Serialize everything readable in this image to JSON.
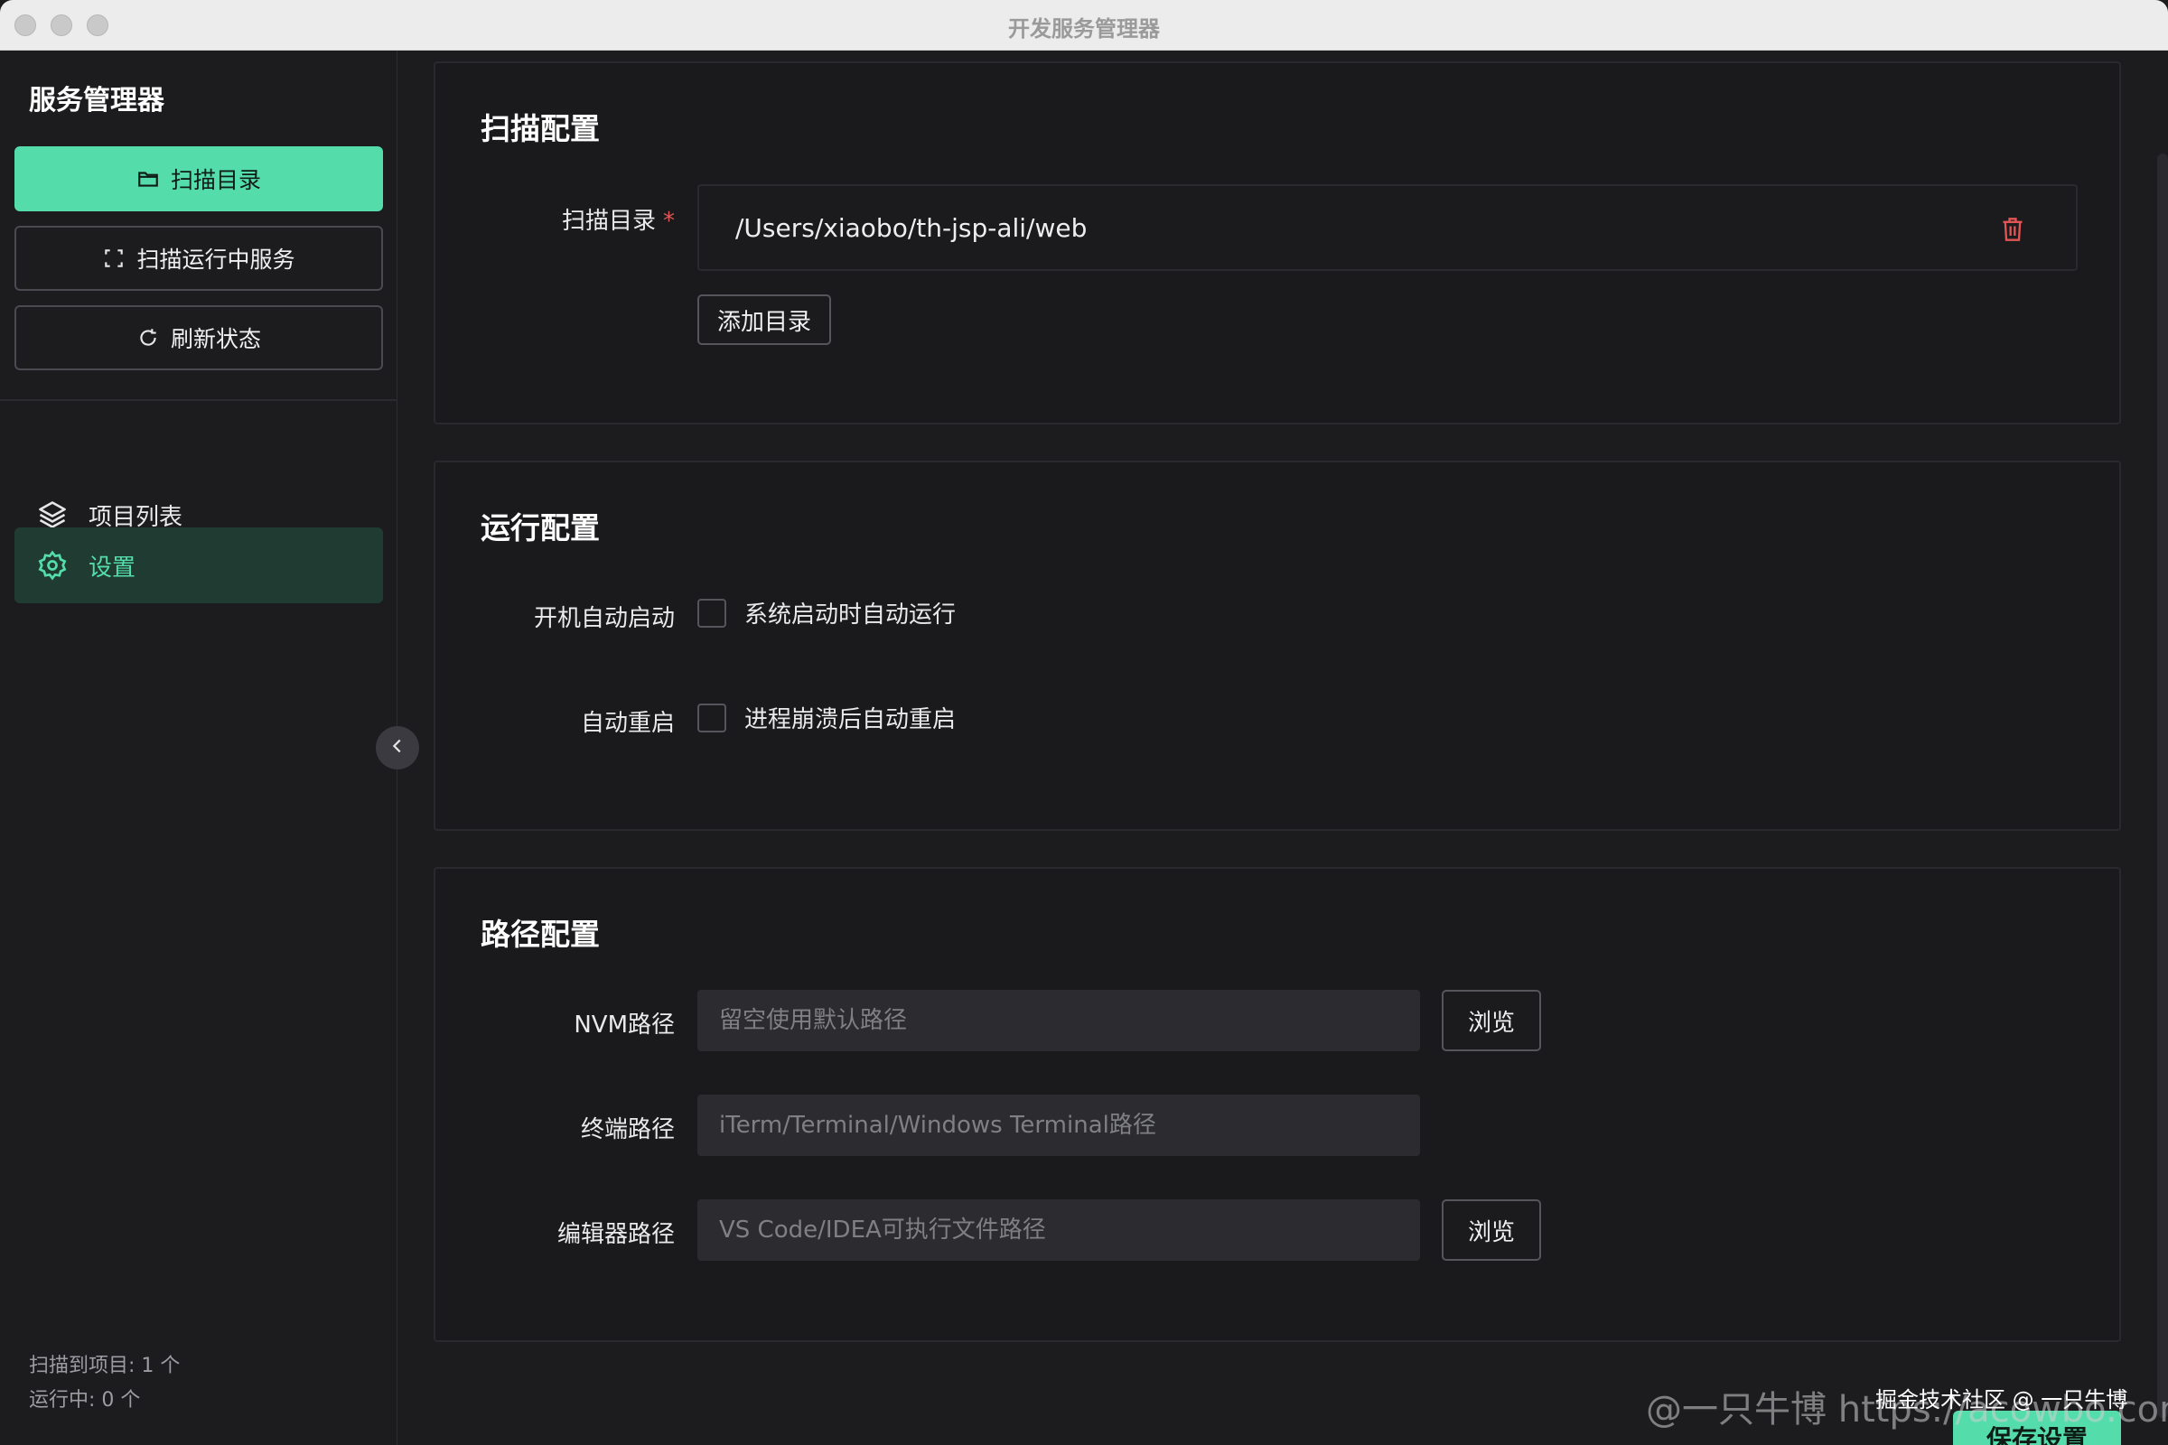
{
  "window": {
    "title": "开发服务管理器"
  },
  "sidebar": {
    "brand": "服务管理器",
    "actions": [
      {
        "label": "扫描目录",
        "icon": "folder-icon"
      },
      {
        "label": "扫描运行中服务",
        "icon": "scan-frame-icon"
      },
      {
        "label": "刷新状态",
        "icon": "refresh-icon"
      }
    ],
    "nav": [
      {
        "label": "项目列表",
        "icon": "layers-icon"
      },
      {
        "label": "设置",
        "icon": "gear-icon",
        "active": true
      }
    ],
    "stats": {
      "scanned": "扫描到项目: 1 个",
      "running": "运行中: 0 个"
    }
  },
  "scan_config": {
    "title": "扫描配置",
    "dir_label": "扫描目录",
    "required_mark": "*",
    "dir_value": "/Users/xiaobo/th-jsp-ali/web",
    "add_dir": "添加目录"
  },
  "run_config": {
    "title": "运行配置",
    "autostart_label": "开机自动启动",
    "autostart_text": "系统启动时自动运行",
    "autostart_checked": false,
    "autorestart_label": "自动重启",
    "autorestart_text": "进程崩溃后自动重启",
    "autorestart_checked": false
  },
  "path_config": {
    "title": "路径配置",
    "nvm_label": "NVM路径",
    "nvm_placeholder": "留空使用默认路径",
    "nvm_value": "",
    "terminal_label": "终端路径",
    "terminal_placeholder": "iTerm/Terminal/Windows Terminal路径",
    "terminal_value": "",
    "editor_label": "编辑器路径",
    "editor_placeholder": "VS Code/IDEA可执行文件路径",
    "editor_value": "",
    "browse": "浏览"
  },
  "footer": {
    "save": "保存设置",
    "watermark": "@一只牛博 https://acowbo.com",
    "community": "掘金技术社区 @ 一只牛博"
  },
  "colors": {
    "accent": "#54dcab",
    "active_bg": "#1f3b32",
    "danger": "#e25555",
    "bg": "#1c1c1f"
  }
}
